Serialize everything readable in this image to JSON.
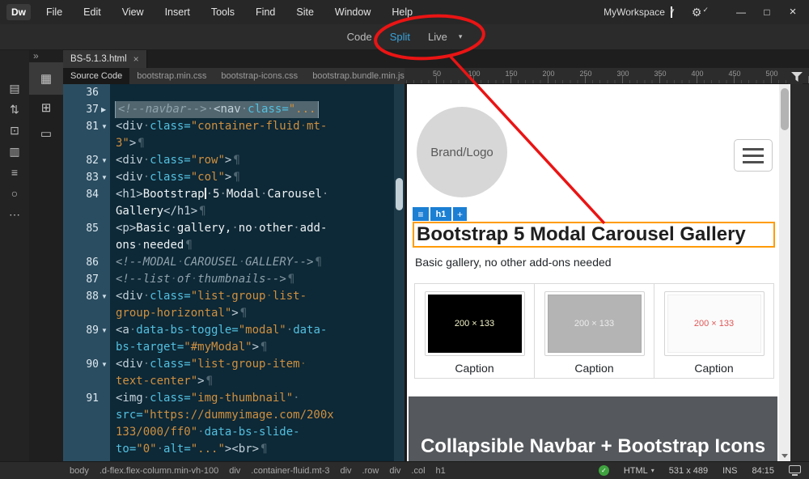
{
  "colors": {
    "accent_blue": "#38a3dc",
    "annotation_red": "#ea1414",
    "selection_orange": "#ff9c00",
    "hud_blue": "#1b7fd4",
    "lint_green": "#3fa33f"
  },
  "titlebar": {
    "logo": "Dw",
    "menus": [
      "File",
      "Edit",
      "View",
      "Insert",
      "Tools",
      "Find",
      "Site",
      "Window",
      "Help"
    ],
    "workspace_label": "MyWorkspace",
    "workspace_caret": "▾",
    "gear_icon": "⚙",
    "gear_check": "✓",
    "window_controls": [
      {
        "name": "minimize-button",
        "glyph": "—"
      },
      {
        "name": "maximize-button",
        "glyph": "□"
      },
      {
        "name": "close-button",
        "glyph": "×"
      }
    ]
  },
  "view_toolbar": {
    "modes": [
      {
        "label": "Code",
        "active": false
      },
      {
        "label": "Split",
        "active": true
      },
      {
        "label": "Live",
        "active": false
      }
    ],
    "dropdown_caret": "▾"
  },
  "left_rail": {
    "collapse_chevron": "»",
    "toolbar_icons": [
      {
        "name": "open-documents-icon",
        "glyph": "▤"
      },
      {
        "name": "file-management-icon",
        "glyph": "⇅"
      },
      {
        "name": "live-view-options-icon",
        "glyph": "⊡"
      },
      {
        "name": "inspect-icon",
        "glyph": "▥"
      },
      {
        "name": "outline-icon",
        "glyph": "≡"
      },
      {
        "name": "linting-icon",
        "glyph": "○"
      },
      {
        "name": "customize-toolbar-icon",
        "glyph": "⋯"
      }
    ],
    "panel_icons": [
      {
        "name": "files-panel-icon",
        "glyph": "▦",
        "active": true
      },
      {
        "name": "site-map-icon",
        "glyph": "⊞",
        "active": false
      },
      {
        "name": "device-preview-icon",
        "glyph": "▭",
        "active": false
      }
    ]
  },
  "document_tab": {
    "label": "BS-5.1.3.html",
    "close_glyph": "×"
  },
  "related_files": [
    {
      "label": "Source Code",
      "active": true
    },
    {
      "label": "bootstrap.min.css",
      "active": false
    },
    {
      "label": "bootstrap-icons.css",
      "active": false
    },
    {
      "label": "bootstrap.bundle.min.js",
      "active": false
    }
  ],
  "code_editor": {
    "lines": [
      {
        "num": "36",
        "fold": "",
        "dls": [
          []
        ]
      },
      {
        "num": "37",
        "fold": "collapsed",
        "selected": true,
        "dls": [
          [
            {
              "t": "comment",
              "s": "<!--navbar-->"
            },
            {
              "t": "plain",
              "s": "·"
            },
            {
              "t": "tag",
              "s": "<nav"
            },
            {
              "t": "plain",
              "s": "·"
            },
            {
              "t": "attr",
              "s": "class="
            },
            {
              "t": "val",
              "s": "\"..."
            }
          ]
        ]
      },
      {
        "num": "81",
        "fold": "open",
        "dls": [
          [
            {
              "t": "tag",
              "s": "<div"
            },
            {
              "t": "plain",
              "s": "·"
            },
            {
              "t": "attr",
              "s": "class="
            },
            {
              "t": "val",
              "s": "\"container-fluid·mt-"
            }
          ],
          [
            {
              "t": "val",
              "s": "3\""
            },
            {
              "t": "tag",
              "s": ">"
            },
            {
              "t": "eol",
              "s": "¶"
            }
          ]
        ]
      },
      {
        "num": "82",
        "fold": "open",
        "dls": [
          [
            {
              "t": "tag",
              "s": "<div"
            },
            {
              "t": "plain",
              "s": "·"
            },
            {
              "t": "attr",
              "s": "class="
            },
            {
              "t": "val",
              "s": "\"row\""
            },
            {
              "t": "tag",
              "s": ">"
            },
            {
              "t": "eol",
              "s": "¶"
            }
          ]
        ]
      },
      {
        "num": "83",
        "fold": "open",
        "dls": [
          [
            {
              "t": "tag",
              "s": "<div"
            },
            {
              "t": "plain",
              "s": "·"
            },
            {
              "t": "attr",
              "s": "class="
            },
            {
              "t": "val",
              "s": "\"col\""
            },
            {
              "t": "tag",
              "s": ">"
            },
            {
              "t": "eol",
              "s": "¶"
            }
          ]
        ]
      },
      {
        "num": "84",
        "fold": "",
        "dls": [
          [
            {
              "t": "tag",
              "s": "<h1>"
            },
            {
              "t": "text",
              "s": "Bootstrap"
            },
            {
              "t": "caret",
              "s": ""
            },
            {
              "t": "text",
              "s": "·5·Modal·Carousel·"
            }
          ],
          [
            {
              "t": "text",
              "s": "Gallery"
            },
            {
              "t": "tag",
              "s": "</h1>"
            },
            {
              "t": "eol",
              "s": "¶"
            }
          ]
        ]
      },
      {
        "num": "85",
        "fold": "",
        "dls": [
          [
            {
              "t": "tag",
              "s": "<p>"
            },
            {
              "t": "text",
              "s": "Basic·gallery,·no·other·add-"
            }
          ],
          [
            {
              "t": "text",
              "s": "ons·needed"
            },
            {
              "t": "eol",
              "s": "¶"
            }
          ]
        ]
      },
      {
        "num": "86",
        "fold": "",
        "dls": [
          [
            {
              "t": "comment",
              "s": "<!--MODAL·CAROUSEL·GALLERY-->"
            },
            {
              "t": "eol",
              "s": "¶"
            }
          ]
        ]
      },
      {
        "num": "87",
        "fold": "",
        "dls": [
          [
            {
              "t": "comment",
              "s": "<!--list·of·thumbnails-->"
            },
            {
              "t": "eol",
              "s": "¶"
            }
          ]
        ]
      },
      {
        "num": "88",
        "fold": "open",
        "dls": [
          [
            {
              "t": "tag",
              "s": "<div"
            },
            {
              "t": "plain",
              "s": "·"
            },
            {
              "t": "attr",
              "s": "class="
            },
            {
              "t": "val",
              "s": "\"list-group·list-"
            }
          ],
          [
            {
              "t": "val",
              "s": "group-horizontal\""
            },
            {
              "t": "tag",
              "s": ">"
            },
            {
              "t": "eol",
              "s": "¶"
            }
          ]
        ]
      },
      {
        "num": "89",
        "fold": "open",
        "dls": [
          [
            {
              "t": "tag",
              "s": "<a"
            },
            {
              "t": "plain",
              "s": "·"
            },
            {
              "t": "attr",
              "s": "data-bs-toggle="
            },
            {
              "t": "val",
              "s": "\"modal\""
            },
            {
              "t": "plain",
              "s": "·"
            },
            {
              "t": "attr",
              "s": "data-"
            }
          ],
          [
            {
              "t": "attr",
              "s": "bs-target="
            },
            {
              "t": "val",
              "s": "\"#myModal\""
            },
            {
              "t": "tag",
              "s": ">"
            },
            {
              "t": "eol",
              "s": "¶"
            }
          ]
        ]
      },
      {
        "num": "90",
        "fold": "open",
        "dls": [
          [
            {
              "t": "tag",
              "s": "<div"
            },
            {
              "t": "plain",
              "s": "·"
            },
            {
              "t": "attr",
              "s": "class="
            },
            {
              "t": "val",
              "s": "\"list-group-item·"
            }
          ],
          [
            {
              "t": "val",
              "s": "text-center\""
            },
            {
              "t": "tag",
              "s": ">"
            },
            {
              "t": "eol",
              "s": "¶"
            }
          ]
        ]
      },
      {
        "num": "91",
        "fold": "",
        "dls": [
          [
            {
              "t": "tag",
              "s": "<img"
            },
            {
              "t": "plain",
              "s": "·"
            },
            {
              "t": "attr",
              "s": "class="
            },
            {
              "t": "val",
              "s": "\"img-thumbnail\""
            },
            {
              "t": "plain",
              "s": "·"
            }
          ],
          [
            {
              "t": "attr",
              "s": "src="
            },
            {
              "t": "val",
              "s": "\"https://dummyimage.com/200x"
            }
          ],
          [
            {
              "t": "val",
              "s": "133/000/ff0\""
            },
            {
              "t": "plain",
              "s": "·"
            },
            {
              "t": "attr",
              "s": "data-bs-slide-"
            }
          ],
          [
            {
              "t": "attr",
              "s": "to="
            },
            {
              "t": "val",
              "s": "\"0\""
            },
            {
              "t": "plain",
              "s": "·"
            },
            {
              "t": "attr",
              "s": "alt="
            },
            {
              "t": "val",
              "s": "\"...\""
            },
            {
              "t": "tag",
              "s": "><br>"
            },
            {
              "t": "eol",
              "s": "¶"
            }
          ]
        ]
      }
    ]
  },
  "live_view": {
    "ruler_labels": [
      "50",
      "100",
      "150",
      "200",
      "250",
      "300",
      "350",
      "400",
      "450",
      "500"
    ],
    "brand_text": "Brand/Logo",
    "element_hud": {
      "drag_glyph": "≡",
      "h1_label": "h1",
      "add_label": "+"
    },
    "heading": "Bootstrap 5 Modal Carousel Gallery",
    "paragraph": "Basic gallery, no other add-ons needed",
    "cards": [
      {
        "size_label": "200 × 133",
        "caption": "Caption",
        "image_bg": "#000000",
        "label_color": "#f4f4c8"
      },
      {
        "size_label": "200 × 133",
        "caption": "Caption",
        "image_bg": "#b4b4b4",
        "label_color": "#ececec"
      },
      {
        "size_label": "200 × 133",
        "caption": "Caption",
        "image_bg": "#fbfbfb",
        "label_color": "#e05656"
      }
    ],
    "next_section_heading": "Collapsible Navbar + Bootstrap Icons"
  },
  "status_bar": {
    "tag_selectors": [
      "body",
      ".d-flex.flex-column.min-vh-100",
      "div",
      ".container-fluid.mt-3",
      "div",
      ".row",
      "div",
      ".col",
      "h1"
    ],
    "lint_ok_glyph": "✓",
    "doc_type": "HTML",
    "doc_type_caret": "▾",
    "dimensions": "531 x 489",
    "insert_mode": "INS",
    "cursor_position": "84:15"
  }
}
